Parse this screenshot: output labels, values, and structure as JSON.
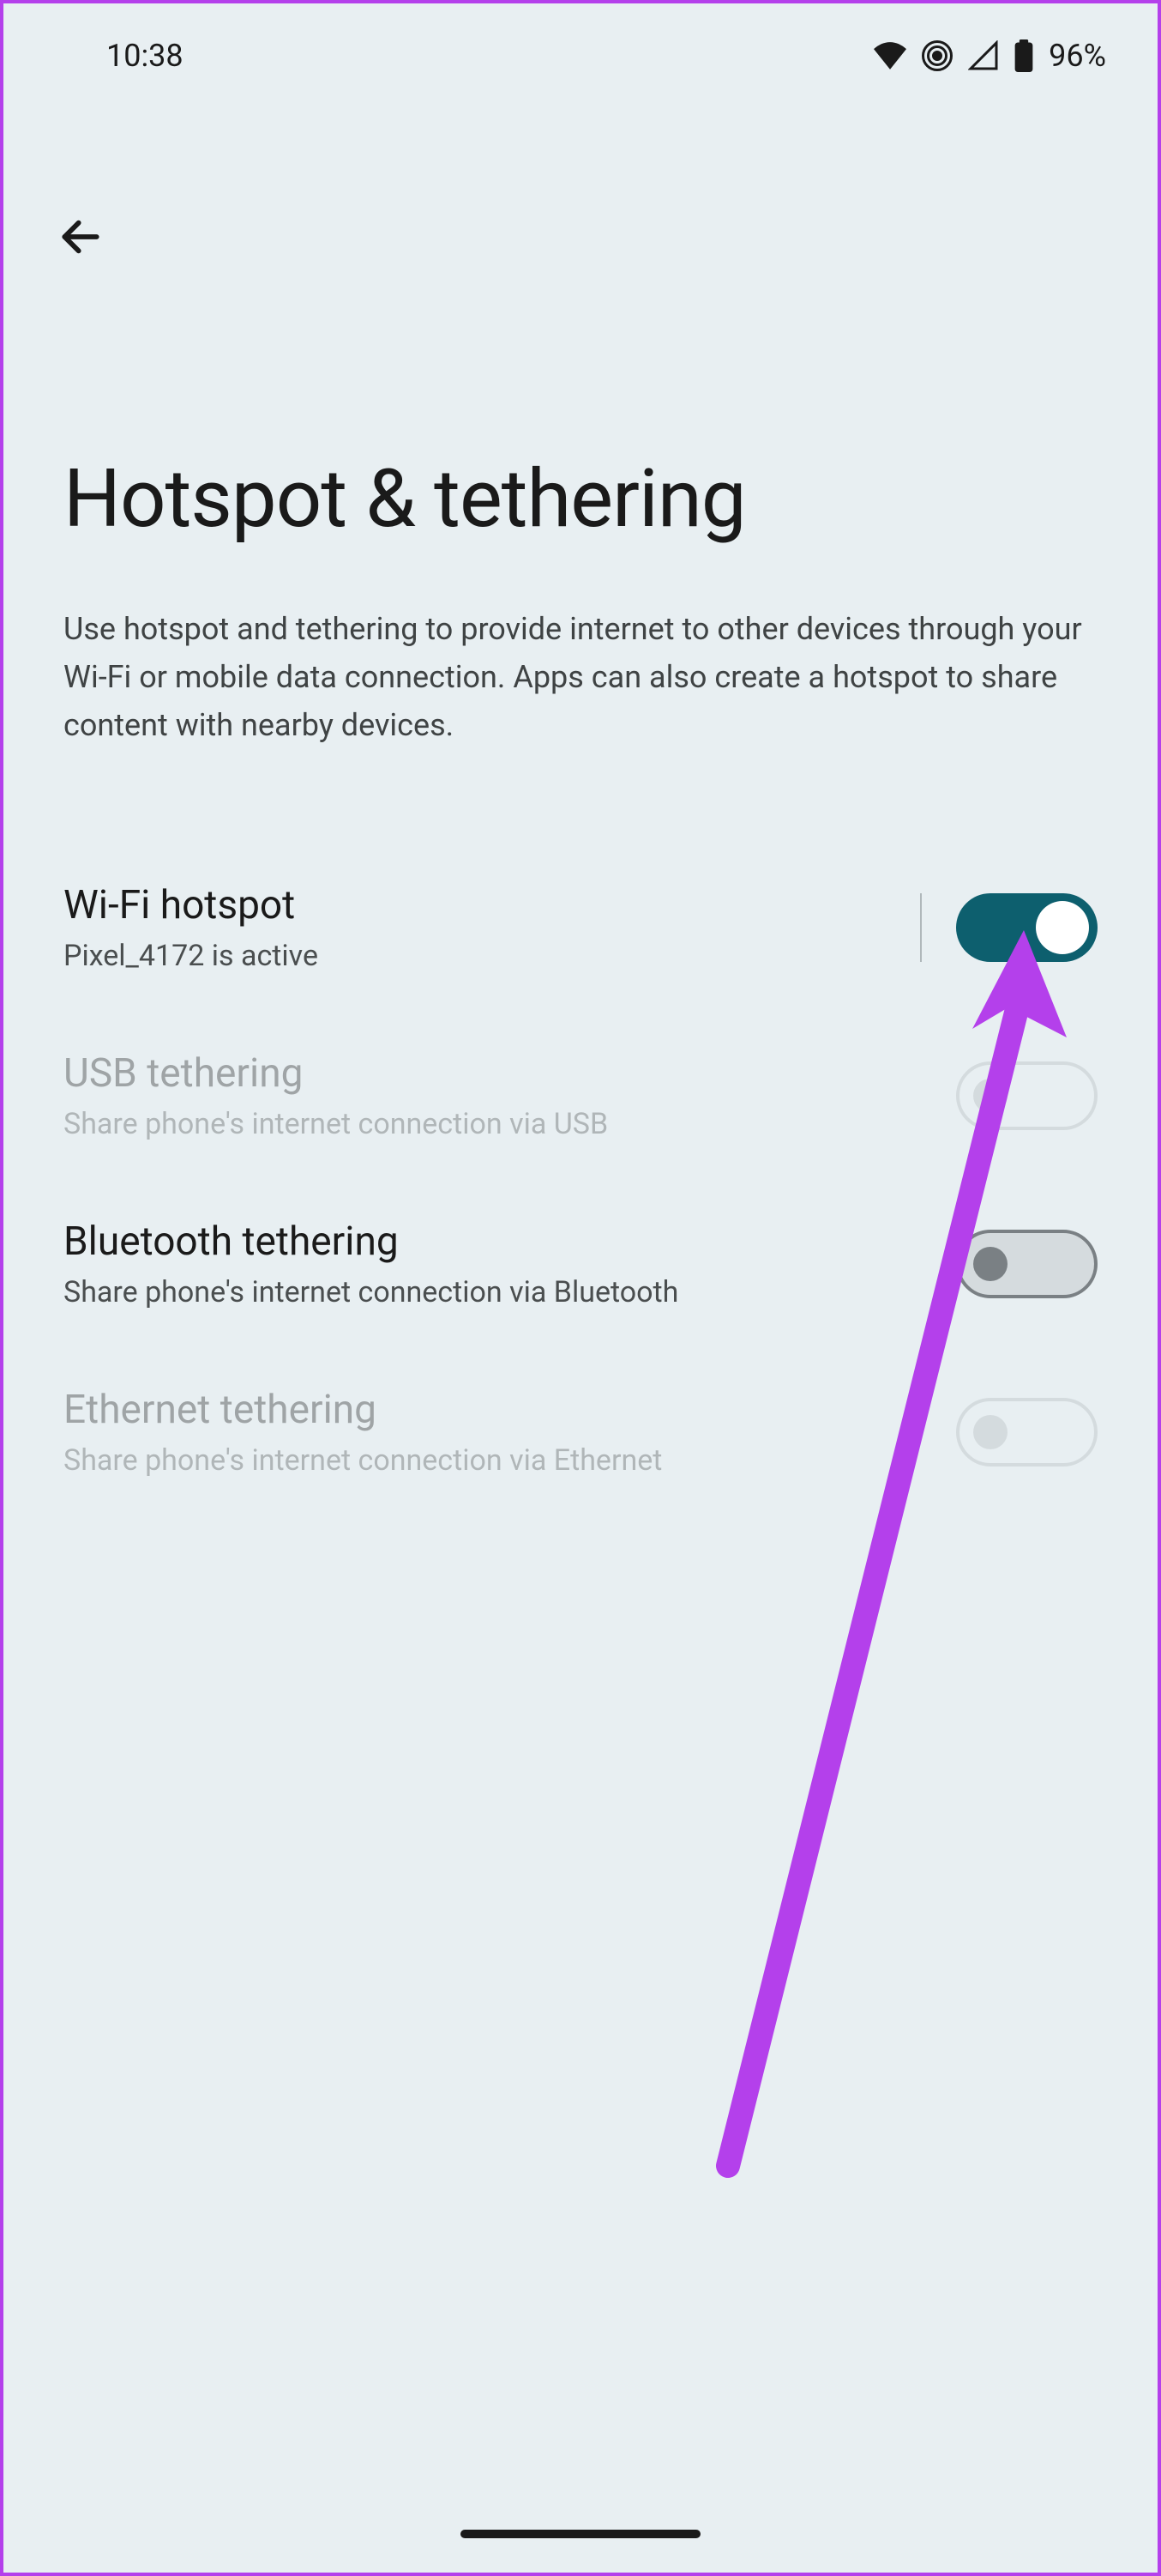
{
  "statusBar": {
    "time": "10:38",
    "batteryPercent": "96%"
  },
  "page": {
    "title": "Hotspot & tethering",
    "description": "Use hotspot and tethering to provide internet to other devices through your Wi-Fi or mobile data connection. Apps can also create a hotspot to share content with nearby devices."
  },
  "settings": {
    "wifiHotspot": {
      "title": "Wi-Fi hotspot",
      "subtitle": "Pixel_4172 is active"
    },
    "usbTethering": {
      "title": "USB tethering",
      "subtitle": "Share phone's internet connection via USB"
    },
    "bluetoothTethering": {
      "title": "Bluetooth tethering",
      "subtitle": "Share phone's internet connection via Bluetooth"
    },
    "ethernetTethering": {
      "title": "Ethernet tethering",
      "subtitle": "Share phone's internet connection via Ethernet"
    }
  }
}
